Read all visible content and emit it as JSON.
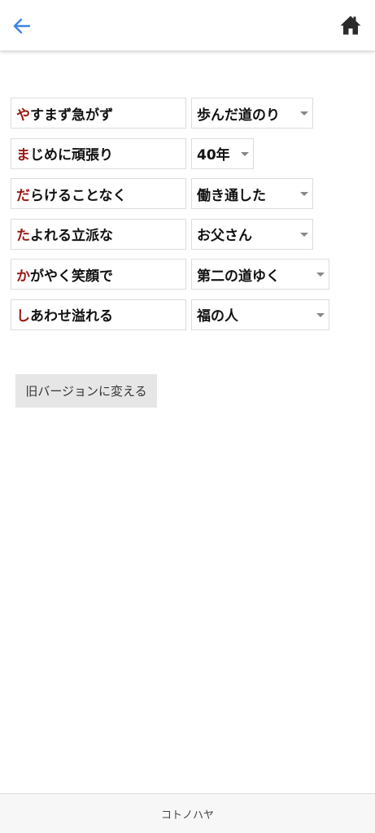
{
  "header": {
    "back_icon": "arrow-left-icon",
    "home_icon": "home-icon",
    "accent_color": "#3d85e0"
  },
  "rows": [
    {
      "first": "や",
      "rest": "すまず急がず",
      "selected": "歩んだ道のり"
    },
    {
      "first": "ま",
      "rest": "じめに頑張り",
      "selected": "40年"
    },
    {
      "first": "だ",
      "rest": "らけることなく",
      "selected": "働き通した"
    },
    {
      "first": "た",
      "rest": "よれる立派な",
      "selected": "お父さん"
    },
    {
      "first": "か",
      "rest": "がやく笑顔で",
      "selected": "第二の道ゆく"
    },
    {
      "first": "し",
      "rest": "あわせ溢れる",
      "selected": "福の人"
    }
  ],
  "colors": {
    "first_char": "#9a1a14"
  },
  "old_version_button": "旧バージョンに変える",
  "footer": {
    "brand": "コトノハヤ"
  }
}
